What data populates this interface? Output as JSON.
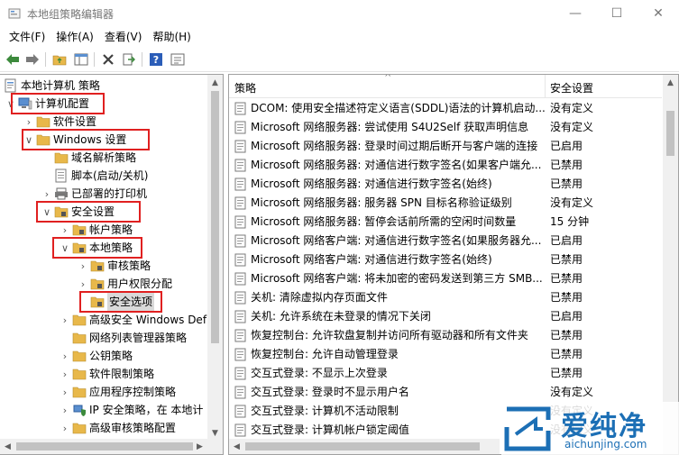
{
  "window": {
    "title": "本地组策略编辑器",
    "controls": {
      "minimize": "—",
      "maximize": "☐",
      "close": "✕"
    }
  },
  "menu": [
    "文件(F)",
    "操作(A)",
    "查看(V)",
    "帮助(H)"
  ],
  "toolbar": [
    "back-icon",
    "forward-icon",
    "up-folder-icon",
    "show-hide-tree-icon",
    "delete-icon",
    "export-icon",
    "help-icon",
    "properties-icon"
  ],
  "tree": {
    "root": "本地计算机 策略",
    "items": [
      {
        "label": "计算机配置"
      },
      {
        "label": "软件设置"
      },
      {
        "label": "Windows 设置"
      },
      {
        "label": "域名解析策略"
      },
      {
        "label": "脚本(启动/关机)"
      },
      {
        "label": "已部署的打印机"
      },
      {
        "label": "安全设置"
      },
      {
        "label": "帐户策略"
      },
      {
        "label": "本地策略"
      },
      {
        "label": "审核策略"
      },
      {
        "label": "用户权限分配"
      },
      {
        "label": "安全选项"
      },
      {
        "label": "高级安全 Windows Def"
      },
      {
        "label": "网络列表管理器策略"
      },
      {
        "label": "公钥策略"
      },
      {
        "label": "软件限制策略"
      },
      {
        "label": "应用程序控制策略"
      },
      {
        "label": "IP 安全策略，在 本地计"
      },
      {
        "label": "高级审核策略配置"
      }
    ]
  },
  "list": {
    "headers": {
      "policy": "策略",
      "setting": "安全设置"
    },
    "rows": [
      {
        "policy": "DCOM: 使用安全描述符定义语言(SDDL)语法的计算机启动...",
        "setting": "没有定义"
      },
      {
        "policy": "Microsoft 网络服务器: 尝试使用 S4U2Self 获取声明信息",
        "setting": "没有定义"
      },
      {
        "policy": "Microsoft 网络服务器: 登录时间过期后断开与客户端的连接",
        "setting": "已启用"
      },
      {
        "policy": "Microsoft 网络服务器: 对通信进行数字签名(如果客户端允...",
        "setting": "已禁用"
      },
      {
        "policy": "Microsoft 网络服务器: 对通信进行数字签名(始终)",
        "setting": "已禁用"
      },
      {
        "policy": "Microsoft 网络服务器: 服务器 SPN 目标名称验证级别",
        "setting": "没有定义"
      },
      {
        "policy": "Microsoft 网络服务器: 暂停会话前所需的空闲时间数量",
        "setting": "15 分钟"
      },
      {
        "policy": "Microsoft 网络客户端: 对通信进行数字签名(如果服务器允...",
        "setting": "已启用"
      },
      {
        "policy": "Microsoft 网络客户端: 对通信进行数字签名(始终)",
        "setting": "已禁用"
      },
      {
        "policy": "Microsoft 网络客户端: 将未加密的密码发送到第三方 SMB...",
        "setting": "已禁用"
      },
      {
        "policy": "关机: 清除虚拟内存页面文件",
        "setting": "已禁用"
      },
      {
        "policy": "关机: 允许系统在未登录的情况下关闭",
        "setting": "已启用"
      },
      {
        "policy": "恢复控制台: 允许软盘复制并访问所有驱动器和所有文件夹",
        "setting": "已禁用"
      },
      {
        "policy": "恢复控制台: 允许自动管理登录",
        "setting": "已禁用"
      },
      {
        "policy": "交互式登录: 不显示上次登录",
        "setting": "已禁用"
      },
      {
        "policy": "交互式登录: 登录时不显示用户名",
        "setting": "没有定义"
      },
      {
        "policy": "交互式登录: 计算机不活动限制",
        "setting": "没有定义"
      },
      {
        "policy": "交互式登录: 计算机帐户锁定阈值",
        "setting": "没有定义"
      }
    ]
  },
  "watermark": {
    "brand": "爱纯净",
    "url": "aichunjing.com"
  },
  "colors": {
    "highlight": "#e02020",
    "folder": "#e8b84a",
    "accent": "#1c6fb5"
  }
}
